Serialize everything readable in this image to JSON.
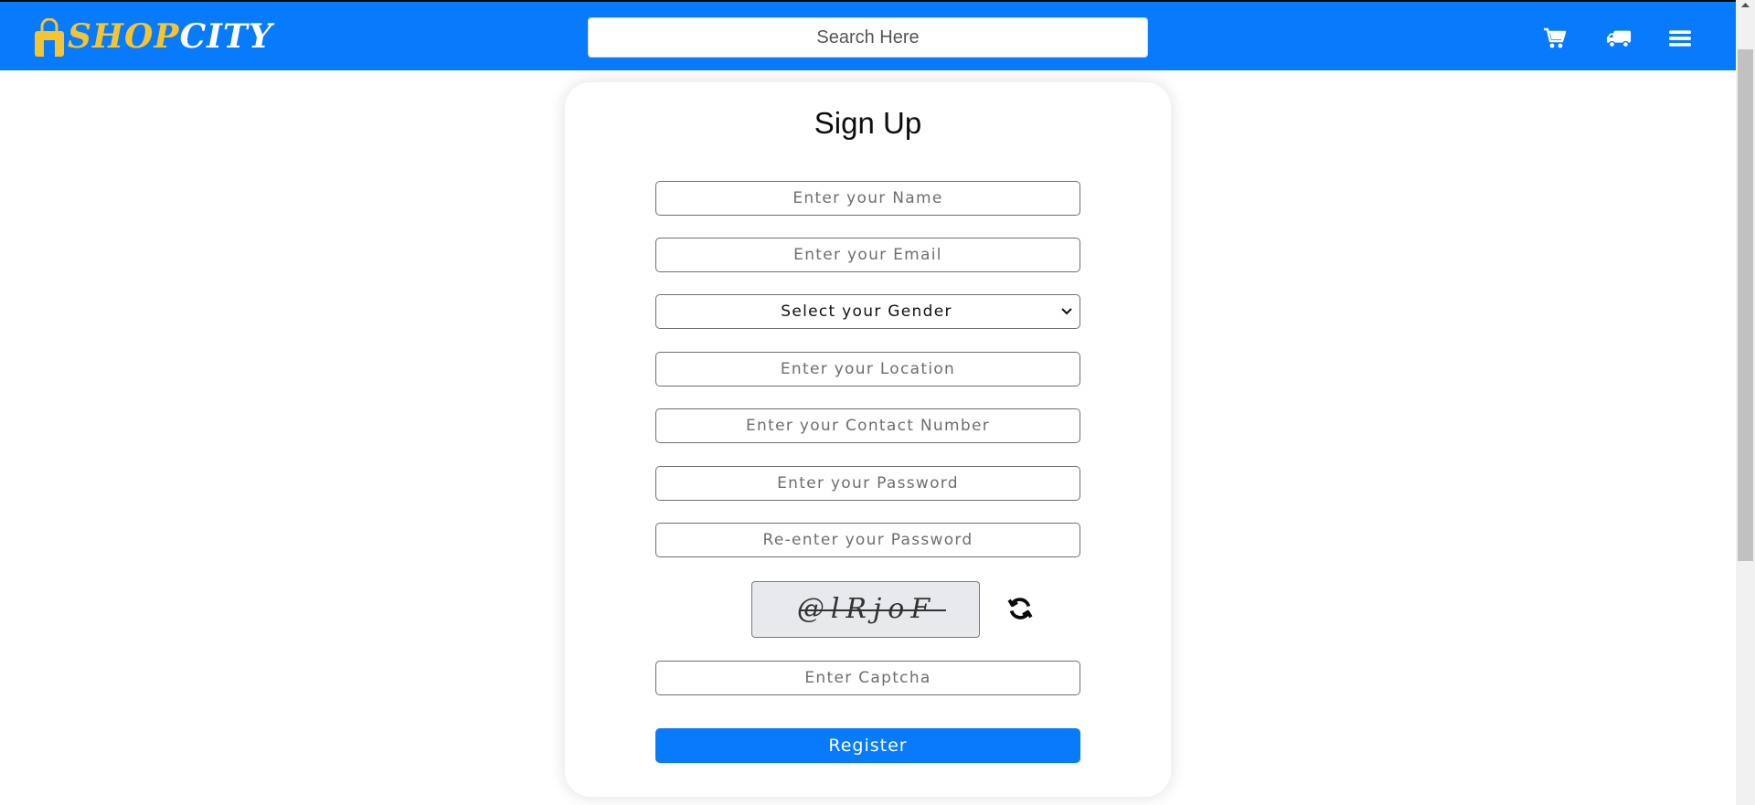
{
  "navbar": {
    "logo": {
      "part1": "SHOP",
      "part2": "CITY",
      "bag_icon": "shopping-bag-icon"
    },
    "search": {
      "placeholder": "Search Here",
      "value": ""
    },
    "icons": [
      "cart-icon",
      "truck-icon",
      "menu-icon"
    ]
  },
  "form": {
    "title": "Sign Up",
    "fields": {
      "name": "Enter your Name",
      "email": "Enter your Email",
      "location": "Enter your Location",
      "contact": "Enter your Contact Number",
      "password": "Enter your Password",
      "confirm_password": "Re-enter your Password",
      "captcha": "Enter Captcha"
    },
    "gender": {
      "selected": "Select your Gender",
      "icon": "chevron-down-icon"
    },
    "captcha": {
      "text": "@lRjoF",
      "refresh_icon": "refresh-icon"
    },
    "register_label": "Register"
  },
  "colors": {
    "primary": "#077bfb",
    "logo_accent": "#f5c431",
    "page_bg": "#ffffff",
    "captcha_bg": "#e8e9ec"
  }
}
